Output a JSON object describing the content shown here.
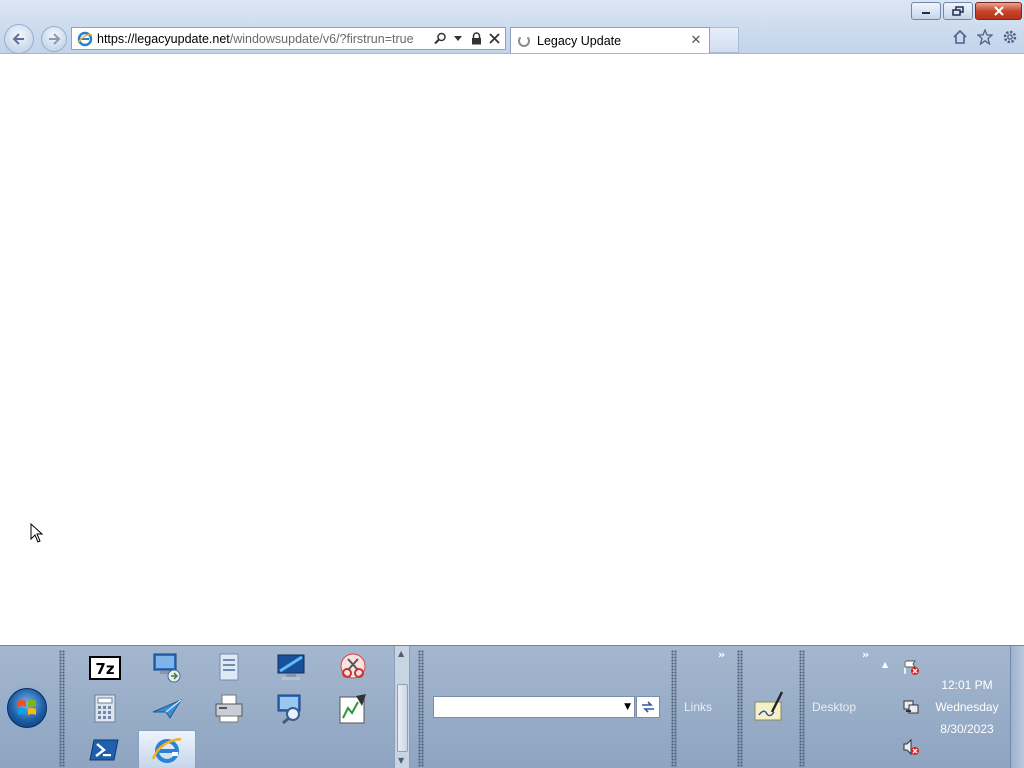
{
  "browser": {
    "address": {
      "scheme": "https://",
      "host": "legacyupdate.net",
      "path": "/windowsupdate/v6/?firstrun=true"
    },
    "tab": {
      "title": "Legacy Update",
      "loading": true
    },
    "nav": {
      "back_icon": "back-arrow-icon",
      "forward_icon": "forward-arrow-icon"
    },
    "command_icons": [
      "home-icon",
      "favorites-star-icon",
      "tools-gear-icon"
    ]
  },
  "taskbar": {
    "quick_launch": [
      "7zip-icon",
      "remote-desktop-icon",
      "notepad-doc-icon",
      "monitor-icon",
      "snipping-tool-icon",
      "calculator-icon",
      "paper-plane-icon",
      "fax-printer-icon",
      "search-computer-icon",
      "chart-icon",
      "powershell-icon",
      "internet-explorer-icon"
    ],
    "links_label": "Links",
    "desktop_label": "Desktop",
    "clock": {
      "time": "12:01 PM",
      "day": "Wednesday",
      "date": "8/30/2023"
    },
    "tray_icons": [
      "action-center-flag-icon",
      "network-icon",
      "volume-muted-icon"
    ]
  },
  "colors": {
    "taskbar": "#97abc6",
    "chrome": "#cbdaee",
    "close_button": "#c9462c"
  }
}
